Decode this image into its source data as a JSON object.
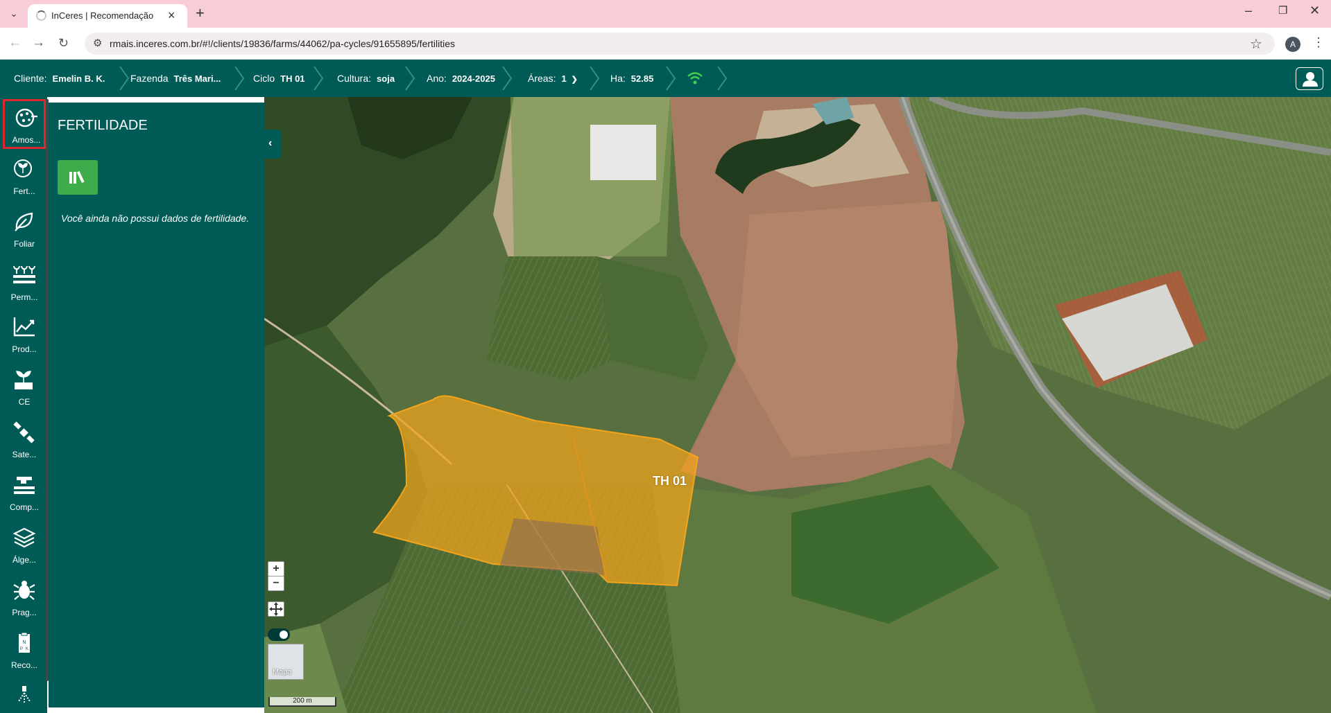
{
  "browser": {
    "tab_title": "InCeres | Recomendação",
    "tab_close": "×",
    "new_tab": "+",
    "url": "rmais.inceres.com.br/#!/clients/19836/farms/44062/pa-cycles/91655895/fertilities",
    "profile_initial": "A",
    "window_controls": {
      "minimize": "–",
      "restore": "❐",
      "close": "✕"
    }
  },
  "topbar": {
    "cliente": {
      "label": "Cliente:",
      "value": "Emelin B. K."
    },
    "fazenda": {
      "label": "Fazenda",
      "value": "Três Mari..."
    },
    "ciclo": {
      "label": "Ciclo",
      "value": "TH 01"
    },
    "cultura": {
      "label": "Cultura:",
      "value": "soja"
    },
    "ano": {
      "label": "Ano:",
      "value": "2024-2025"
    },
    "areas": {
      "label": "Áreas:",
      "value": "1"
    },
    "ha": {
      "label": "Ha:",
      "value": "52.85"
    },
    "connection_icon": "wifi-icon",
    "user_icon": "user-icon"
  },
  "sidebar": {
    "items": [
      {
        "label": "Amos...",
        "icon": "soil-sample-icon",
        "active": true
      },
      {
        "label": "Fert...",
        "icon": "fertility-icon"
      },
      {
        "label": "Foliar",
        "icon": "leaf-icon"
      },
      {
        "label": "Perm...",
        "icon": "perennial-crop-icon"
      },
      {
        "label": "Prod...",
        "icon": "productivity-chart-icon"
      },
      {
        "label": "CE",
        "icon": "plant-conductivity-icon"
      },
      {
        "label": "Sate...",
        "icon": "satellite-icon"
      },
      {
        "label": "Comp...",
        "icon": "compaction-icon"
      },
      {
        "label": "Álge...",
        "icon": "layers-icon"
      },
      {
        "label": "Prag...",
        "icon": "bug-icon"
      },
      {
        "label": "Reco...",
        "icon": "recommendation-icon"
      },
      {
        "label": "",
        "icon": "sprayer-icon"
      }
    ]
  },
  "panel": {
    "title": "FERTILIDADE",
    "library_icon": "library-icon",
    "empty_message": "Você ainda não possui dados de fertilidade.",
    "collapse_icon": "chevron-left-icon"
  },
  "map": {
    "field_label": "TH 01",
    "field_color": "#f4a51c",
    "zoom_in": "+",
    "zoom_out": "−",
    "pan_icon": "move-icon",
    "basemap_label": "Mapa",
    "scale_label": "200 m"
  },
  "colors": {
    "brand": "#005b56",
    "accent_green": "#3fac4b",
    "active_outline": "#e0262e",
    "tabstrip": "#f9cdd8"
  }
}
